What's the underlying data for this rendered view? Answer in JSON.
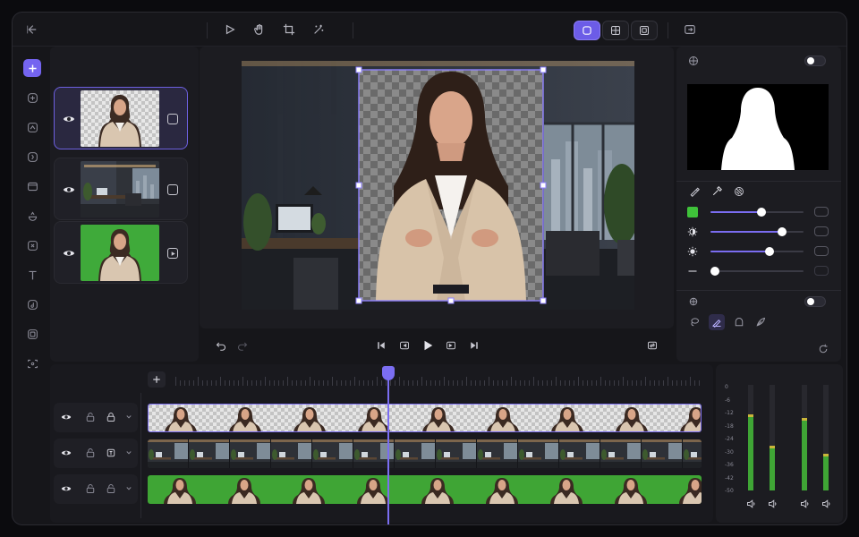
{
  "window": {
    "title": "",
    "accent": "#7464f0",
    "green": "#3fa535"
  },
  "toolbar": {
    "icons": [
      "back-icon",
      "play-icon",
      "hand-icon",
      "crop-icon",
      "magic-icon"
    ],
    "view_modes": [
      "single-view",
      "grid-view",
      "frame-view"
    ],
    "active_view": "single-view"
  },
  "sidebar": {
    "tools": [
      "add",
      "ai-generate",
      "stickers",
      "effects",
      "templates",
      "filters",
      "transitions",
      "text",
      "audio",
      "media",
      "captions"
    ]
  },
  "layers": [
    {
      "name": "Woman (background removed)",
      "visible": true,
      "active": true,
      "kind": "cutout"
    },
    {
      "name": "Office background",
      "visible": true,
      "active": false,
      "kind": "image"
    },
    {
      "name": "Green screen footage",
      "visible": true,
      "active": false,
      "kind": "video"
    }
  ],
  "right_panel": {
    "matte_toggle_on": false,
    "adjustments": [
      {
        "name": "key-color",
        "value": 0.55
      },
      {
        "name": "contrast",
        "value": 0.77
      },
      {
        "name": "brightness",
        "value": 0.63
      },
      {
        "name": "edge",
        "value": 0.05
      }
    ],
    "mask_toggle_on": false
  },
  "timeline": {
    "tracks": [
      {
        "name": "cutout-track",
        "locked": false
      },
      {
        "name": "background-track",
        "locked": false
      },
      {
        "name": "greenscreen-track",
        "locked": false
      }
    ]
  },
  "audio_meter": {
    "db_labels": [
      "0",
      "-6",
      "-12",
      "-18",
      "-24",
      "-30",
      "-36",
      "-42",
      "-50"
    ],
    "levels": [
      0.72,
      0.42,
      0.69,
      0.35
    ]
  }
}
